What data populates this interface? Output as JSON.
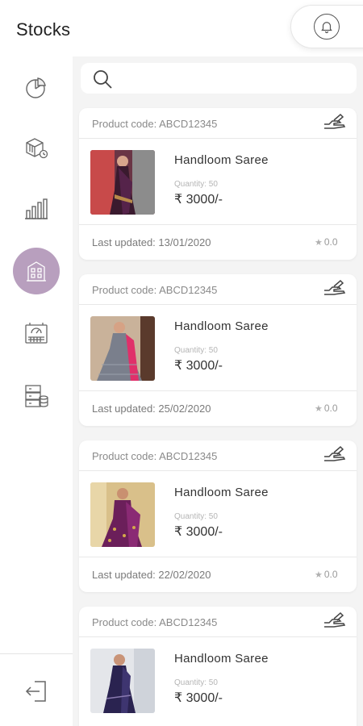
{
  "header": {
    "title": "Stocks",
    "bell_icon": "bell-icon"
  },
  "sidebar": {
    "items": [
      {
        "icon": "pie-chart-icon",
        "active": false
      },
      {
        "icon": "inventory-boxes-icon",
        "active": false
      },
      {
        "icon": "bar-chart-icon",
        "active": false
      },
      {
        "icon": "warehouse-building-icon",
        "active": true
      },
      {
        "icon": "dashboard-gauge-icon",
        "active": false
      },
      {
        "icon": "database-list-icon",
        "active": false
      }
    ],
    "logout_icon": "logout-icon",
    "accent_color": "#b89fbe"
  },
  "search": {
    "placeholder": "",
    "icon": "search-icon"
  },
  "products": [
    {
      "code": "Product code: ABCD12345",
      "name": "Handloom Saree",
      "quantity": "Quantity: 50",
      "price": "₹ 3000/-",
      "updated": "Last updated: 13/01/2020",
      "rating": "0.0"
    },
    {
      "code": "Product code: ABCD12345",
      "name": "Handloom Saree",
      "quantity": "Quantity: 50",
      "price": "₹ 3000/-",
      "updated": "Last updated: 25/02/2020",
      "rating": "0.0"
    },
    {
      "code": "Product code: ABCD12345",
      "name": "Handloom Saree",
      "quantity": "Quantity: 50",
      "price": "₹ 3000/-",
      "updated": "Last updated: 22/02/2020",
      "rating": "0.0"
    },
    {
      "code": "Product code: ABCD12345",
      "name": "Handloom Saree",
      "quantity": "Quantity: 50",
      "price": "₹ 3000/-",
      "updated": "",
      "rating": ""
    }
  ]
}
